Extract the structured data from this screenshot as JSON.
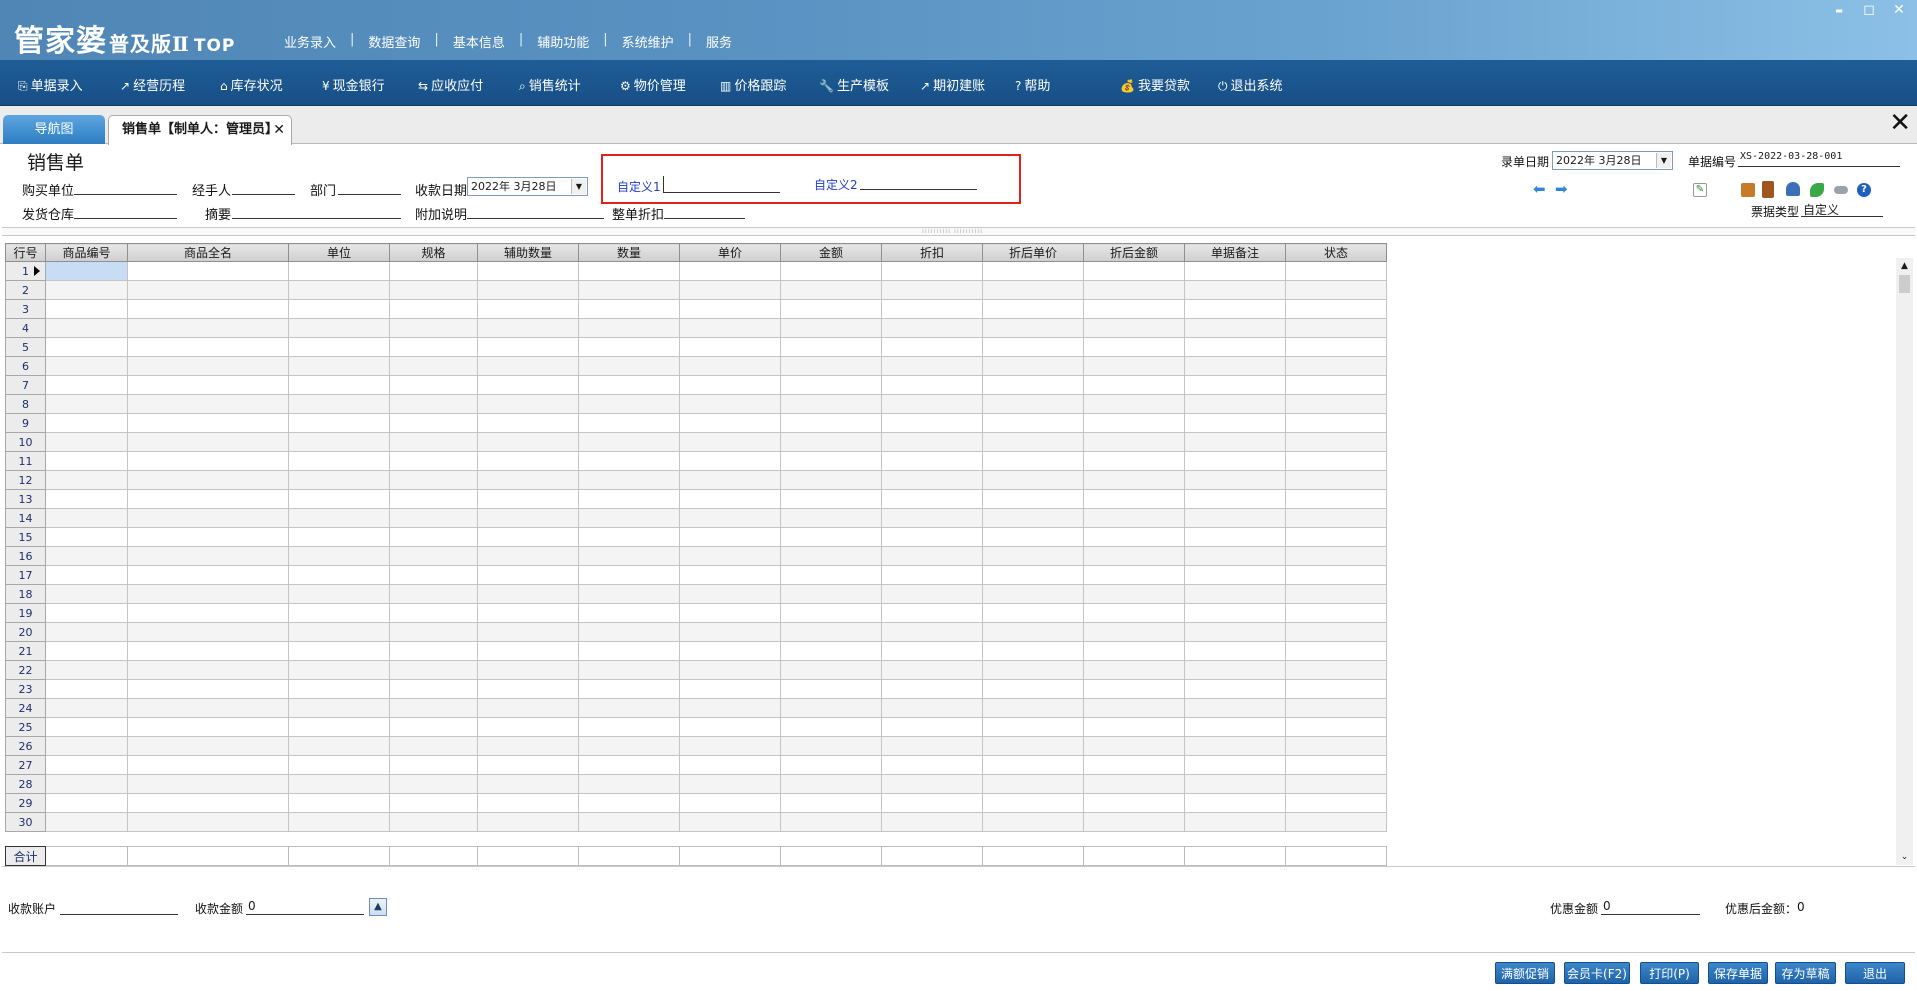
{
  "app": {
    "logo_main": "管家婆",
    "logo_edition": "普及版Ⅱ",
    "logo_top": "TOP",
    "menu": [
      "业务录入",
      "数据查询",
      "基本信息",
      "辅助功能",
      "系统维护",
      "服务"
    ],
    "menu_sep": "|",
    "window_controls": {
      "minimize": "▬",
      "restore": "◻",
      "close": "✕"
    }
  },
  "toolbar": [
    {
      "label": "单据录入",
      "icon": "document-entry-icon"
    },
    {
      "label": "经营历程",
      "icon": "trend-chart-icon"
    },
    {
      "label": "库存状况",
      "icon": "warehouse-home-icon"
    },
    {
      "label": "现金银行",
      "icon": "yen-icon"
    },
    {
      "label": "应收应付",
      "icon": "exchange-arrows-icon"
    },
    {
      "label": "销售统计",
      "icon": "search-icon"
    },
    {
      "label": "物价管理",
      "icon": "gear-icon"
    },
    {
      "label": "价格跟踪",
      "icon": "bar-chart-icon"
    },
    {
      "label": "生产模板",
      "icon": "wrench-icon"
    },
    {
      "label": "期初建账",
      "icon": "external-link-icon"
    },
    {
      "label": "帮助",
      "icon": "help-icon"
    },
    {
      "label": "我要贷款",
      "icon": "money-bag-icon"
    },
    {
      "label": "退出系统",
      "icon": "power-icon"
    }
  ],
  "toolbar_glyphs": [
    "⎘",
    "↗",
    "⌂",
    "¥",
    "⇆",
    "⌕",
    "⚙",
    "▥",
    "🔧",
    "↗",
    "?",
    "💰",
    "⏻"
  ],
  "tabs": {
    "nav": "导航图",
    "active": "销售单【制单人：管理员】",
    "close": "✕",
    "close_all": "✕"
  },
  "form": {
    "title": "销售单",
    "buyer_label": "购买单位",
    "buyer_value": "",
    "handler_label": "经手人",
    "handler_value": "",
    "dept_label": "部门",
    "dept_value": "",
    "pay_date_label": "收款日期",
    "pay_date_value": "2022年 3月28日",
    "custom1_label": "自定义1",
    "custom1_value": "",
    "custom2_label": "自定义2",
    "custom2_value": "",
    "warehouse_label": "发货仓库",
    "warehouse_value": "",
    "summary_label": "摘要",
    "summary_value": "",
    "note_label": "附加说明",
    "note_value": "",
    "discount_label": "整单折扣",
    "discount_value": "",
    "entry_date_label": "录单日期",
    "entry_date_value": "2022年 3月28日",
    "doc_no_label": "单据编号",
    "doc_no_value": "XS-2022-03-28-001",
    "ticket_type_label": "票据类型",
    "ticket_type_value": "自定义"
  },
  "grid": {
    "columns": [
      "行号",
      "商品编号",
      "商品全名",
      "单位",
      "规格",
      "辅助数量",
      "数量",
      "单价",
      "金额",
      "折扣",
      "折后单价",
      "折后金额",
      "单据备注",
      "状态"
    ],
    "row_numbers": [
      "1",
      "2",
      "3",
      "4",
      "5",
      "6",
      "7",
      "8",
      "9",
      "10",
      "11",
      "12",
      "13",
      "14",
      "15",
      "16",
      "17",
      "18",
      "19",
      "20",
      "21",
      "22",
      "23",
      "24",
      "25",
      "26",
      "27",
      "28",
      "29",
      "30"
    ],
    "total_label": "合计",
    "scroll_up": "▲",
    "scroll_down": "⌄"
  },
  "footer": {
    "account_label": "收款账户",
    "account_value": "",
    "amount_label": "收款金额",
    "amount_value": "0",
    "discount_amount_label": "优惠金额",
    "discount_amount_value": "0",
    "after_discount_label": "优惠后金额：",
    "after_discount_value": "0",
    "buttons": [
      "满额促销",
      "会员卡(F2)",
      "打印(P)",
      "保存单据",
      "存为草稿",
      "退出"
    ]
  },
  "colors": {
    "title_bar": "#5a93c3",
    "toolbar": "#1f5d96",
    "highlight_box": "#e0241c",
    "custom_label": "#1f3ec8",
    "button": "#2a72b8"
  }
}
